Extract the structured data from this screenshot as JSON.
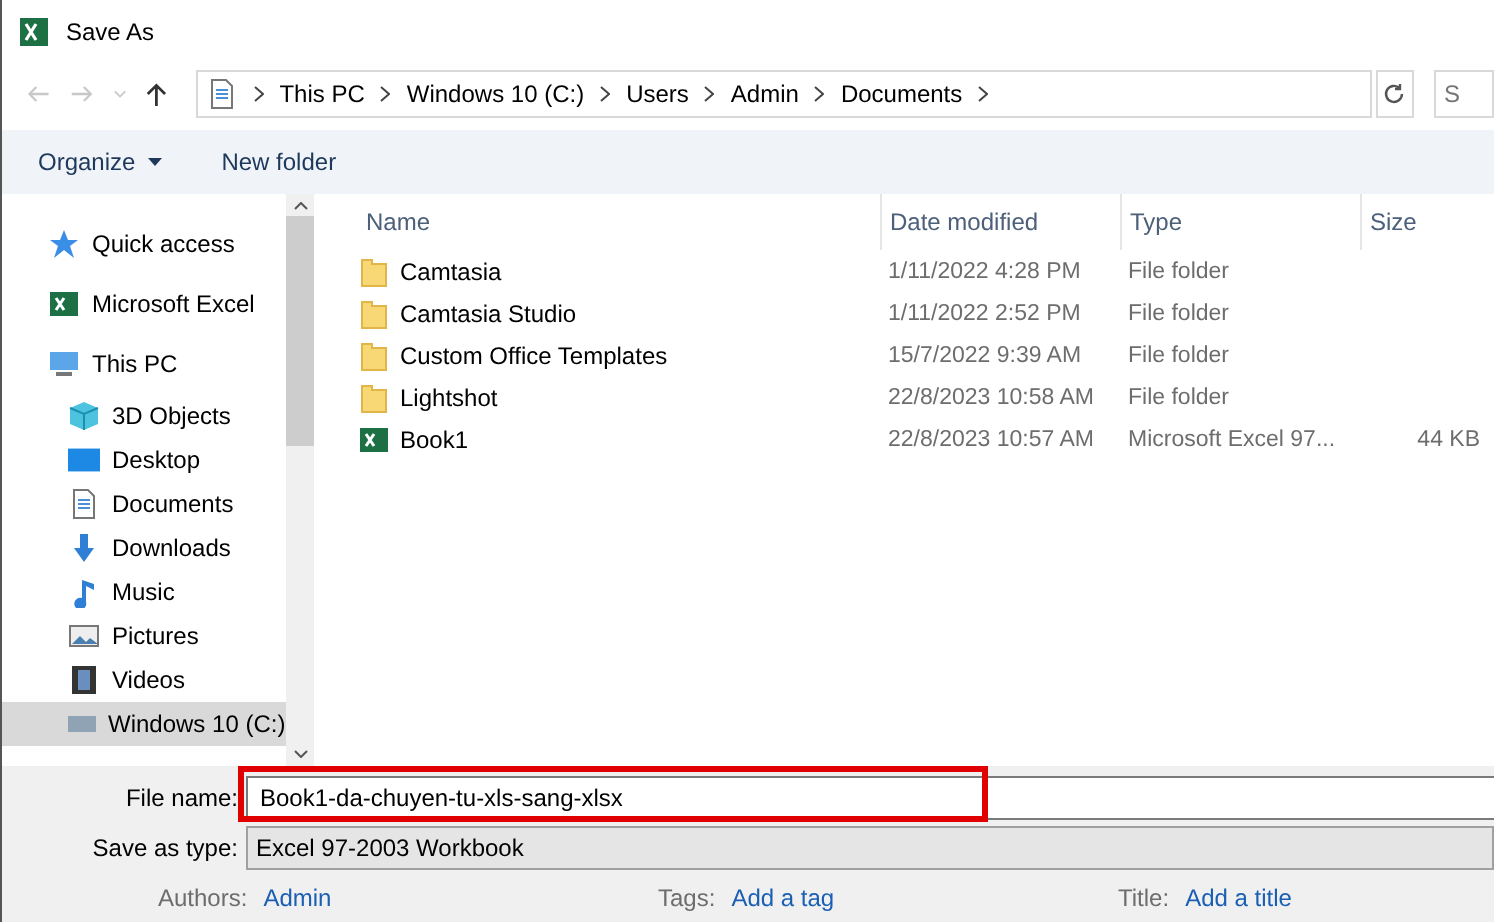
{
  "window": {
    "title": "Save As"
  },
  "address": {
    "crumbs": [
      "This PC",
      "Windows 10 (C:)",
      "Users",
      "Admin",
      "Documents"
    ],
    "search_placeholder": "S"
  },
  "toolbar": {
    "organize": "Organize",
    "new_folder": "New folder"
  },
  "sidebar": {
    "items": [
      {
        "label": "Quick access",
        "kind": "star",
        "selected": false
      },
      {
        "label": "Microsoft Excel",
        "kind": "excel",
        "selected": false
      },
      {
        "label": "This PC",
        "kind": "pc",
        "selected": false,
        "children": [
          {
            "label": "3D Objects",
            "kind": "cube",
            "selected": false
          },
          {
            "label": "Desktop",
            "kind": "desktop",
            "selected": false
          },
          {
            "label": "Documents",
            "kind": "doc",
            "selected": false
          },
          {
            "label": "Downloads",
            "kind": "download",
            "selected": false
          },
          {
            "label": "Music",
            "kind": "music",
            "selected": false
          },
          {
            "label": "Pictures",
            "kind": "picture",
            "selected": false
          },
          {
            "label": "Videos",
            "kind": "video",
            "selected": false
          },
          {
            "label": "Windows 10 (C:)",
            "kind": "drive",
            "selected": true
          }
        ]
      }
    ]
  },
  "table": {
    "columns": [
      "Name",
      "Date modified",
      "Type",
      "Size"
    ],
    "rows": [
      {
        "name": "Camtasia",
        "kind": "folder",
        "date": "1/11/2022 4:28 PM",
        "type": "File folder",
        "size": ""
      },
      {
        "name": "Camtasia Studio",
        "kind": "folder",
        "date": "1/11/2022 2:52 PM",
        "type": "File folder",
        "size": ""
      },
      {
        "name": "Custom Office Templates",
        "kind": "folder",
        "date": "15/7/2022 9:39 AM",
        "type": "File folder",
        "size": ""
      },
      {
        "name": "Lightshot",
        "kind": "folder",
        "date": "22/8/2023 10:58 AM",
        "type": "File folder",
        "size": ""
      },
      {
        "name": "Book1",
        "kind": "excel",
        "date": "22/8/2023 10:57 AM",
        "type": "Microsoft Excel 97...",
        "size": "44 KB"
      }
    ]
  },
  "form": {
    "file_name_label": "File name:",
    "file_name": "Book1-da-chuyen-tu-xls-sang-xlsx",
    "type_label": "Save as type:",
    "type": "Excel 97-2003 Workbook",
    "meta": [
      {
        "label": "Authors:",
        "value": "Admin"
      },
      {
        "label": "Tags:",
        "value": "Add a tag"
      },
      {
        "label": "Title:",
        "value": "Add a title"
      }
    ]
  }
}
